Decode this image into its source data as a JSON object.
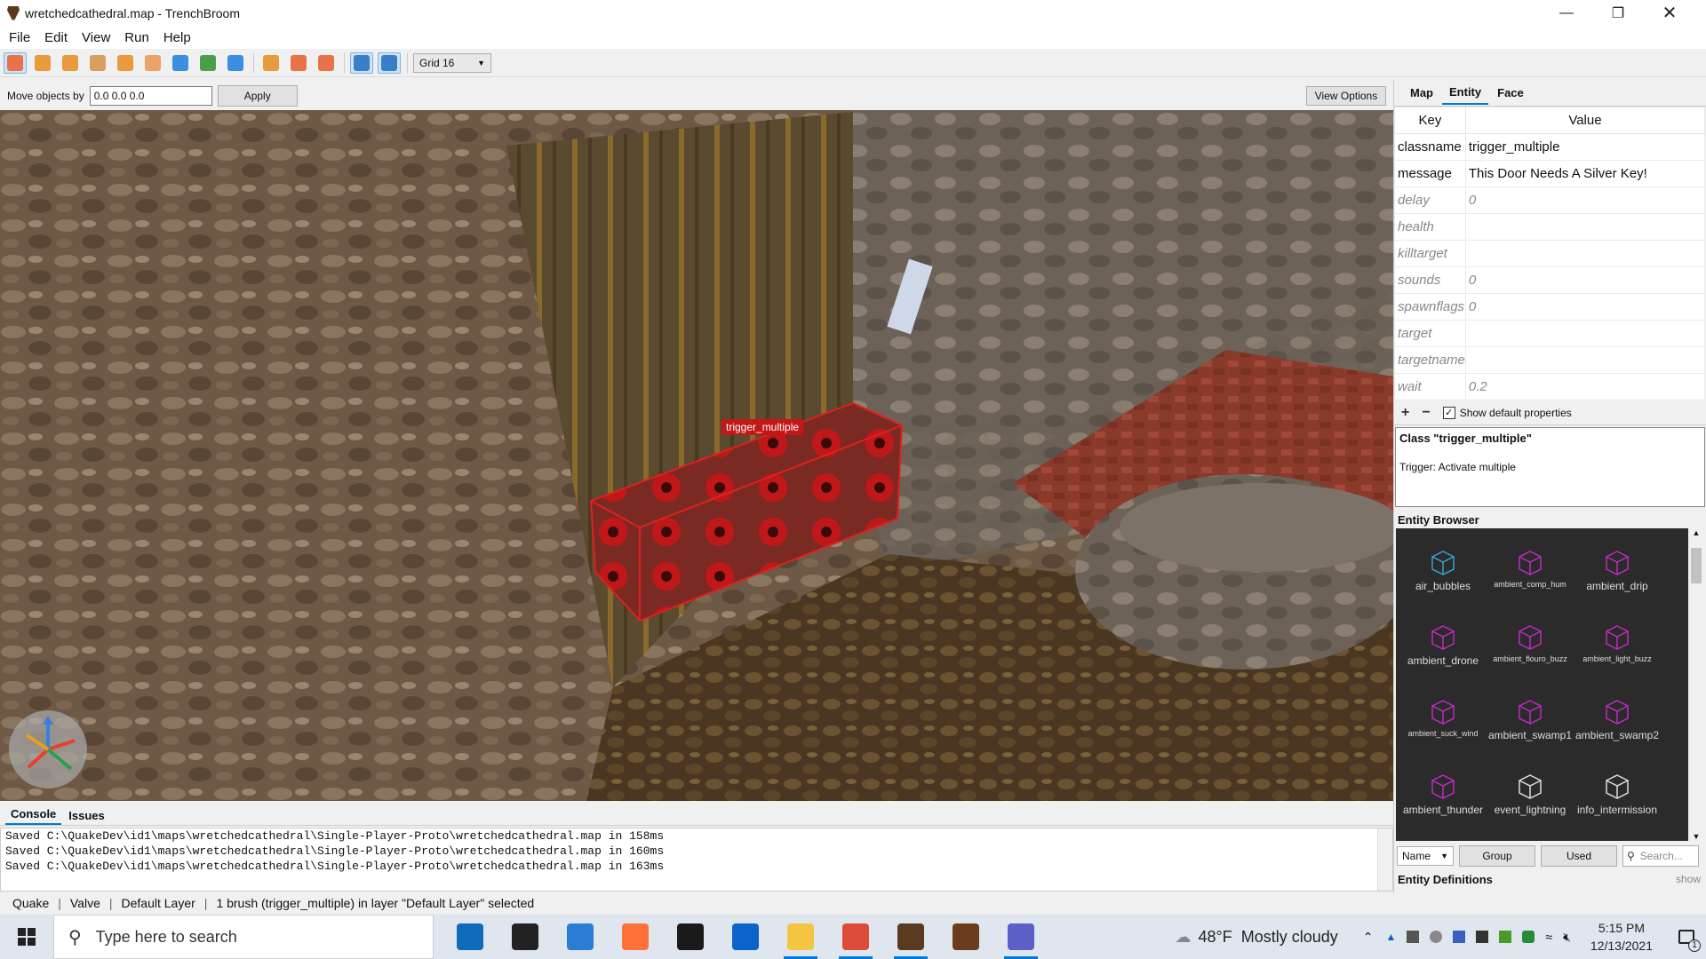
{
  "window": {
    "title": "wretchedcathedral.map - TrenchBroom"
  },
  "menu": [
    "File",
    "Edit",
    "View",
    "Run",
    "Help"
  ],
  "toolbar": {
    "grid_label": "Grid 16",
    "tools": [
      {
        "name": "select-tool",
        "color": "#e8734a",
        "active": true
      },
      {
        "name": "brush-tool",
        "color": "#e89a3c",
        "active": false
      },
      {
        "name": "clip-tool",
        "color": "#e89a3c",
        "active": false
      },
      {
        "name": "vertex-tool",
        "color": "#d8a060",
        "active": false
      },
      {
        "name": "edge-tool",
        "color": "#e89a3c",
        "active": false
      },
      {
        "name": "face-tool",
        "color": "#e8a46a",
        "active": false
      },
      {
        "name": "rotate-tool",
        "color": "#3b8ee0",
        "active": false
      },
      {
        "name": "scale-tool",
        "color": "#4aa04a",
        "active": false
      },
      {
        "name": "shear-tool",
        "color": "#3b8ee0",
        "active": false
      },
      {
        "name": "duplicate-icon",
        "color": "#e89a3c",
        "active": false
      },
      {
        "name": "flip-horizontal-icon",
        "color": "#e8734a",
        "active": false
      },
      {
        "name": "flip-vertical-icon",
        "color": "#e8734a",
        "active": false
      },
      {
        "name": "texture-lock-icon",
        "color": "#3b7ec8",
        "active": true
      },
      {
        "name": "uv-lock-icon",
        "color": "#3b7ec8",
        "active": true
      }
    ]
  },
  "movebar": {
    "label": "Move objects by",
    "value": "0.0 0.0 0.0",
    "apply": "Apply",
    "view_options": "View Options"
  },
  "viewport": {
    "selection_label": "trigger_multiple"
  },
  "console": {
    "tabs": [
      "Console",
      "Issues"
    ],
    "lines": [
      "Saved C:\\QuakeDev\\id1\\maps\\wretchedcathedral\\Single-Player-Proto\\wretchedcathedral.map in 158ms",
      "Saved C:\\QuakeDev\\id1\\maps\\wretchedcathedral\\Single-Player-Proto\\wretchedcathedral.map in 160ms",
      "Saved C:\\QuakeDev\\id1\\maps\\wretchedcathedral\\Single-Player-Proto\\wretchedcathedral.map in 163ms"
    ]
  },
  "status": {
    "game": "Quake",
    "format": "Valve",
    "layer": "Default Layer",
    "selection": "1 brush (trigger_multiple) in layer \"Default Layer\" selected"
  },
  "inspector": {
    "tabs": [
      "Map",
      "Entity",
      "Face"
    ],
    "headers": {
      "key": "Key",
      "value": "Value"
    },
    "properties": [
      {
        "key": "classname",
        "value": "trigger_multiple",
        "default": false
      },
      {
        "key": "message",
        "value": "This Door Needs A Silver Key!",
        "default": false
      },
      {
        "key": "delay",
        "value": "0",
        "default": true
      },
      {
        "key": "health",
        "value": "",
        "default": true
      },
      {
        "key": "killtarget",
        "value": "",
        "default": true
      },
      {
        "key": "sounds",
        "value": "0",
        "default": true
      },
      {
        "key": "spawnflags",
        "value": "0",
        "default": true
      },
      {
        "key": "target",
        "value": "",
        "default": true
      },
      {
        "key": "targetname",
        "value": "",
        "default": true
      },
      {
        "key": "wait",
        "value": "0.2",
        "default": true
      }
    ],
    "show_default_label": "Show default properties",
    "class_title": "Class \"trigger_multiple\"",
    "class_desc": "Trigger: Activate multiple"
  },
  "entity_browser": {
    "title": "Entity Browser",
    "items": [
      {
        "label": "air_bubbles",
        "color": "#3aa0d0",
        "small": false
      },
      {
        "label": "ambient_comp_hum",
        "color": "#c02ac0",
        "small": true
      },
      {
        "label": "ambient_drip",
        "color": "#c02ac0",
        "small": false
      },
      {
        "label": "ambient_drone",
        "color": "#c02ac0",
        "small": false
      },
      {
        "label": "ambient_flouro_buzz",
        "color": "#c02ac0",
        "small": true
      },
      {
        "label": "ambient_light_buzz",
        "color": "#c02ac0",
        "small": true
      },
      {
        "label": "ambient_suck_wind",
        "color": "#c02ac0",
        "small": true
      },
      {
        "label": "ambient_swamp1",
        "color": "#c02ac0",
        "small": false
      },
      {
        "label": "ambient_swamp2",
        "color": "#c02ac0",
        "small": false
      },
      {
        "label": "ambient_thunder",
        "color": "#c02ac0",
        "small": false
      },
      {
        "label": "event_lightning",
        "color": "#dddddd",
        "small": false
      },
      {
        "label": "info_intermission",
        "color": "#dddddd",
        "small": false
      }
    ],
    "sort": "Name",
    "group": "Group",
    "used": "Used",
    "search_placeholder": "Search..."
  },
  "entity_definitions": {
    "title": "Entity Definitions",
    "toggle": "show"
  },
  "taskbar": {
    "search_placeholder": "Type here to search",
    "apps": [
      {
        "name": "mail-icon",
        "color": "#0f6cbd",
        "running": false
      },
      {
        "name": "notion-icon",
        "color": "#222222",
        "running": false
      },
      {
        "name": "store-icon",
        "color": "#2b7cd3",
        "running": false
      },
      {
        "name": "firefox-icon",
        "color": "#ff7139",
        "running": false
      },
      {
        "name": "dropbox-icon",
        "color": "#1a1a1a",
        "running": false
      },
      {
        "name": "outlook-icon",
        "color": "#0a64c9",
        "running": false
      },
      {
        "name": "file-explorer-icon",
        "color": "#f4c542",
        "running": true
      },
      {
        "name": "chrome-icon",
        "color": "#dd4b39",
        "running": true
      },
      {
        "name": "trenchbroom-icon",
        "color": "#5a3a1e",
        "running": true
      },
      {
        "name": "quake-icon",
        "color": "#6b3d1e",
        "running": false
      },
      {
        "name": "teams-icon",
        "color": "#5b5fc7",
        "running": true
      }
    ],
    "weather_temp": "48°F",
    "weather_desc": "Mostly cloudy",
    "time": "5:15 PM",
    "date": "12/13/2021",
    "notifications": "1"
  }
}
